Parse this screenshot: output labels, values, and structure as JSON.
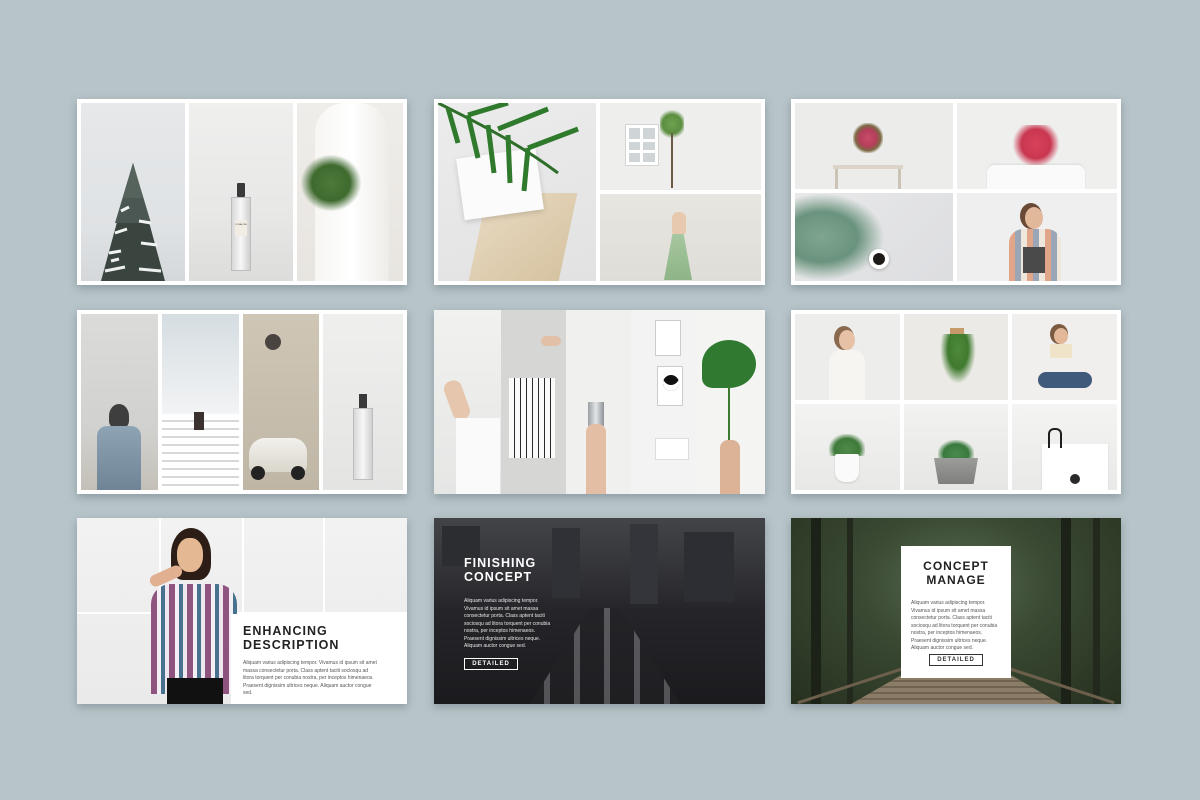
{
  "slides": {
    "s7": {
      "title_line1": "ENHANCING",
      "title_line2": "DESCRIPTION",
      "body": "Aliquam varius adipiscing tempor. Vivamus id ipsum sit amet massa consectetur porta. Class aptent taciti sociosqu ad litora torquent per conubia nostra, per inceptos himenaeos. Praesent dignissim ultrices neque. Aliquam auctor congue sed."
    },
    "s8": {
      "title_line1": "FINISHING",
      "title_line2": "CONCEPT",
      "body": "Aliquam varius adipiscing tempor. Vivamus id ipsum sit amet massa consectetur porta. Class aptent taciti sociosqu ad litora torquent per conubia nostra, per inceptos himenaeos. Praesent dignissim ultrices neque. Aliquam auctor congue sed.",
      "button": "DETAILED"
    },
    "s9": {
      "title_line1": "CONCEPT",
      "title_line2": "MANAGE",
      "body": "Aliquam varius adipiscing tempor. Vivamus id ipsum sit amet massa consectetur porta. Class aptent taciti sociosqu ad litora torquent per conubia nostra, per inceptos himenaeos. Praesent dignissim ultrices neque. Aliquam auctor congue sed.",
      "button": "DETAILED"
    }
  },
  "product_label": "JO MALONE",
  "colors": {
    "background": "#b7c4c9",
    "slide": "#ffffff",
    "dark_overlay": "#2a2a2e",
    "forest": "#3a4a33"
  }
}
